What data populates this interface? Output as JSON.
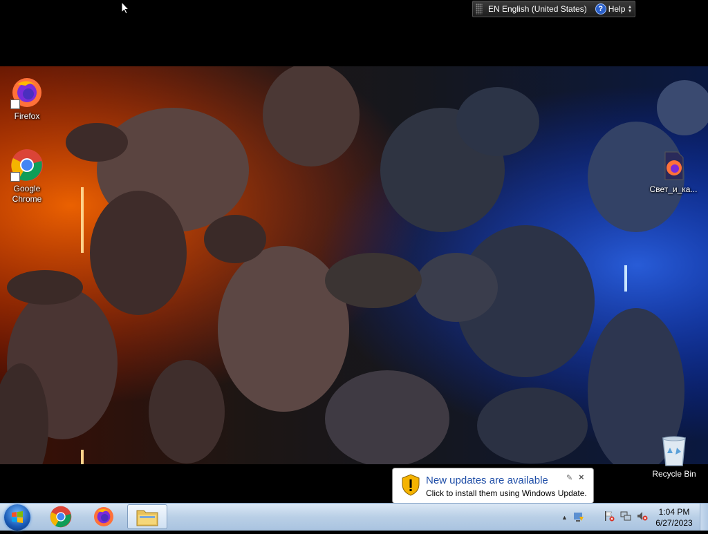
{
  "language_bar": {
    "language": "EN English (United States)",
    "help_label": "Help"
  },
  "desktop_icons": [
    {
      "label": "Firefox"
    },
    {
      "label": "Google Chrome"
    },
    {
      "label": "Свет_и_ка..."
    },
    {
      "label": "Recycle Bin"
    }
  ],
  "notification": {
    "title": "New updates are available",
    "body": "Click to install them using Windows Update."
  },
  "taskbar": {
    "pinned": [
      "google-chrome",
      "firefox",
      "windows-explorer"
    ]
  },
  "clock": {
    "time": "1:04 PM",
    "date": "6/27/2023"
  },
  "colors": {
    "title_blue": "#1f4ea7",
    "taskbar": "#b9cfe6",
    "lava": "#ff4a00",
    "ice": "#1e6bff"
  }
}
